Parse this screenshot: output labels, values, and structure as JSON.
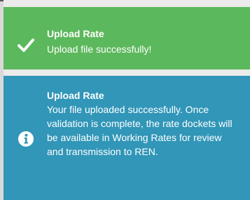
{
  "toasts": {
    "success": {
      "icon": "checkmark-icon",
      "title": "Upload Rate",
      "message": "Upload file successfully!",
      "color": "#5cb85c"
    },
    "info": {
      "icon": "info-circle-icon",
      "title": "Upload Rate",
      "message": "Your file uploaded successfully. Once validation is complete, the rate dockets will be available in Working Rates for review and transmission to REN.",
      "color": "#3196b8"
    }
  }
}
